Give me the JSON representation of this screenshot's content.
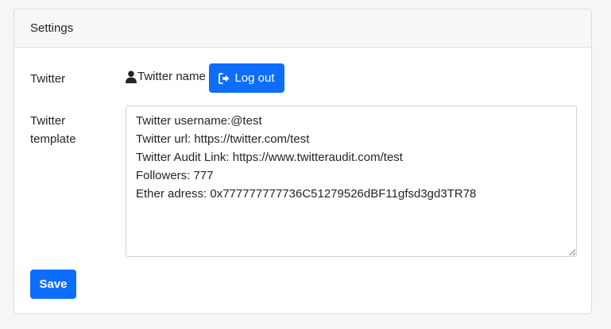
{
  "header": {
    "title": "Settings"
  },
  "twitter_row": {
    "label": "Twitter",
    "username_label": "Twitter name",
    "logout_label": "Log out"
  },
  "template_row": {
    "label": "Twitter template",
    "value": "Twitter username:@test\nTwitter url: https://twitter.com/test\nTwitter Audit Link: https://www.twitteraudit.com/test\nFollowers: 777\nEther adress: 0x777777777736C51279526dBF11gfsd3gd3TR78"
  },
  "footer": {
    "save_label": "Save"
  },
  "icons": {
    "user": "user-icon",
    "logout": "sign-out-icon"
  },
  "colors": {
    "primary": "#0d6efd",
    "header_bg": "#f7f7f7",
    "page_bg": "#f5f6f8"
  }
}
